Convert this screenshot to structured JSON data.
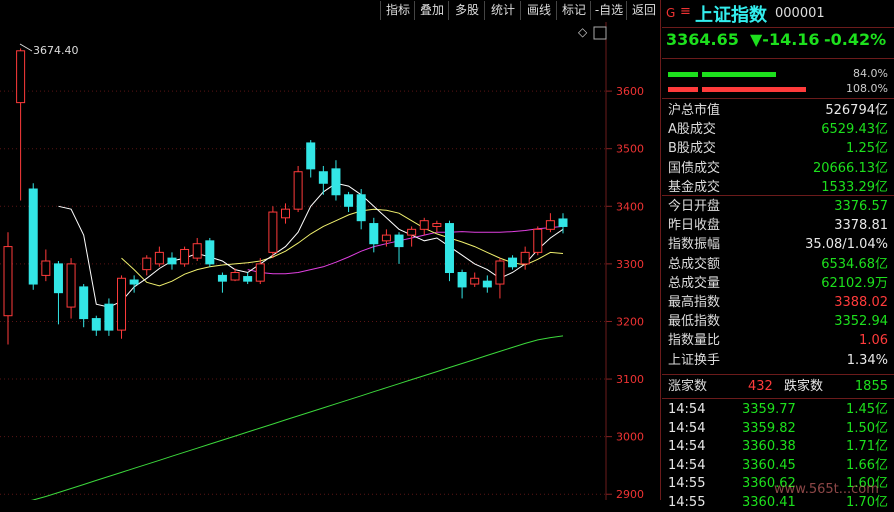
{
  "toolbar": {
    "items": [
      "指标",
      "叠加",
      "多股",
      "统计",
      "画线",
      "标记",
      "-自选",
      "返回"
    ]
  },
  "chart": {
    "y_axis_ticks": [
      "3600",
      "3500",
      "3400",
      "3300",
      "3200",
      "3100",
      "3000",
      "2900"
    ],
    "high_annotation": "3674.40",
    "diamond": "◇",
    "colors": {
      "up": "#ff3b3b",
      "down": "#33e6e6",
      "ma5": "#ffffff",
      "ma10": "#f0f06e",
      "ma20": "#e040e0",
      "ma60": "#3cd83c"
    }
  },
  "chart_data": {
    "type": "candlestick",
    "ylim": [
      2890,
      3720
    ],
    "candles": [
      {
        "o": 3210,
        "c": 3330,
        "h": 3355,
        "l": 3160
      },
      {
        "o": 3580,
        "c": 3670,
        "h": 3674,
        "l": 3410
      },
      {
        "o": 3430,
        "c": 3265,
        "h": 3440,
        "l": 3255
      },
      {
        "o": 3280,
        "c": 3305,
        "h": 3325,
        "l": 3270
      },
      {
        "o": 3300,
        "c": 3250,
        "h": 3305,
        "l": 3195
      },
      {
        "o": 3225,
        "c": 3300,
        "h": 3310,
        "l": 3205
      },
      {
        "o": 3260,
        "c": 3205,
        "h": 3265,
        "l": 3190
      },
      {
        "o": 3205,
        "c": 3185,
        "h": 3210,
        "l": 3175
      },
      {
        "o": 3230,
        "c": 3185,
        "h": 3240,
        "l": 3175
      },
      {
        "o": 3185,
        "c": 3275,
        "h": 3280,
        "l": 3170
      },
      {
        "o": 3272,
        "c": 3265,
        "h": 3280,
        "l": 3250
      },
      {
        "o": 3290,
        "c": 3310,
        "h": 3315,
        "l": 3280
      },
      {
        "o": 3300,
        "c": 3320,
        "h": 3330,
        "l": 3295
      },
      {
        "o": 3310,
        "c": 3300,
        "h": 3320,
        "l": 3290
      },
      {
        "o": 3300,
        "c": 3325,
        "h": 3330,
        "l": 3295
      },
      {
        "o": 3310,
        "c": 3335,
        "h": 3345,
        "l": 3305
      },
      {
        "o": 3340,
        "c": 3300,
        "h": 3345,
        "l": 3295
      },
      {
        "o": 3280,
        "c": 3270,
        "h": 3285,
        "l": 3250
      },
      {
        "o": 3272,
        "c": 3285,
        "h": 3292,
        "l": 3270
      },
      {
        "o": 3278,
        "c": 3270,
        "h": 3285,
        "l": 3265
      },
      {
        "o": 3270,
        "c": 3300,
        "h": 3310,
        "l": 3265
      },
      {
        "o": 3320,
        "c": 3390,
        "h": 3400,
        "l": 3310
      },
      {
        "o": 3380,
        "c": 3395,
        "h": 3405,
        "l": 3370
      },
      {
        "o": 3395,
        "c": 3460,
        "h": 3470,
        "l": 3390
      },
      {
        "o": 3510,
        "c": 3465,
        "h": 3515,
        "l": 3450
      },
      {
        "o": 3460,
        "c": 3440,
        "h": 3470,
        "l": 3420
      },
      {
        "o": 3465,
        "c": 3420,
        "h": 3480,
        "l": 3410
      },
      {
        "o": 3420,
        "c": 3400,
        "h": 3425,
        "l": 3390
      },
      {
        "o": 3420,
        "c": 3375,
        "h": 3430,
        "l": 3360
      },
      {
        "o": 3370,
        "c": 3335,
        "h": 3380,
        "l": 3320
      },
      {
        "o": 3340,
        "c": 3350,
        "h": 3360,
        "l": 3330
      },
      {
        "o": 3350,
        "c": 3330,
        "h": 3355,
        "l": 3300
      },
      {
        "o": 3350,
        "c": 3360,
        "h": 3365,
        "l": 3330
      },
      {
        "o": 3360,
        "c": 3375,
        "h": 3380,
        "l": 3350
      },
      {
        "o": 3365,
        "c": 3370,
        "h": 3375,
        "l": 3355
      },
      {
        "o": 3370,
        "c": 3285,
        "h": 3375,
        "l": 3270
      },
      {
        "o": 3285,
        "c": 3260,
        "h": 3290,
        "l": 3240
      },
      {
        "o": 3265,
        "c": 3275,
        "h": 3285,
        "l": 3260
      },
      {
        "o": 3270,
        "c": 3260,
        "h": 3280,
        "l": 3250
      },
      {
        "o": 3265,
        "c": 3305,
        "h": 3310,
        "l": 3240
      },
      {
        "o": 3310,
        "c": 3295,
        "h": 3315,
        "l": 3290
      },
      {
        "o": 3300,
        "c": 3320,
        "h": 3330,
        "l": 3290
      },
      {
        "o": 3320,
        "c": 3360,
        "h": 3365,
        "l": 3315
      },
      {
        "o": 3360,
        "c": 3375,
        "h": 3388,
        "l": 3355
      },
      {
        "o": 3378,
        "c": 3365,
        "h": 3388,
        "l": 3353
      }
    ],
    "ma5": [
      null,
      null,
      null,
      null,
      3400,
      3395,
      3350,
      3230,
      3225,
      3235,
      3260,
      3275,
      3292,
      3305,
      3310,
      3318,
      3312,
      3305,
      3290,
      3285,
      3300,
      3315,
      3330,
      3355,
      3400,
      3425,
      3440,
      3435,
      3420,
      3400,
      3380,
      3360,
      3350,
      3340,
      3345,
      3330,
      3315,
      3300,
      3290,
      3275,
      3285,
      3300,
      3325,
      3345,
      3360
    ],
    "ma10": [
      null,
      null,
      null,
      null,
      null,
      null,
      null,
      null,
      null,
      3310,
      3290,
      3268,
      3262,
      3270,
      3282,
      3290,
      3295,
      3298,
      3300,
      3302,
      3305,
      3312,
      3322,
      3336,
      3352,
      3365,
      3375,
      3385,
      3392,
      3395,
      3393,
      3388,
      3375,
      3362,
      3352,
      3345,
      3338,
      3330,
      3320,
      3310,
      3302,
      3298,
      3308,
      3320,
      3318
    ],
    "ma20": [
      null,
      null,
      null,
      null,
      null,
      null,
      null,
      null,
      null,
      null,
      null,
      null,
      null,
      null,
      null,
      null,
      null,
      null,
      null,
      3290,
      3285,
      3283,
      3283,
      3285,
      3290,
      3295,
      3303,
      3312,
      3322,
      3330,
      3335,
      3340,
      3345,
      3350,
      3355,
      3355,
      3356,
      3355,
      3355,
      3355,
      3356,
      3358,
      3361,
      3363,
      3365
    ],
    "ma60": [
      2880,
      2885,
      2890,
      2896,
      2903,
      2910,
      2917,
      2924,
      2931,
      2938,
      2945,
      2952,
      2959,
      2966,
      2973,
      2980,
      2987,
      2994,
      3001,
      3008,
      3015,
      3022,
      3029,
      3036,
      3043,
      3050,
      3057,
      3064,
      3071,
      3078,
      3085,
      3092,
      3099,
      3106,
      3113,
      3120,
      3127,
      3134,
      3141,
      3148,
      3155,
      3162,
      3168,
      3172,
      3175
    ]
  },
  "panel": {
    "g": "G",
    "menu_icon": "≡",
    "name": "上证指数",
    "code": "000001",
    "price": "3364.65",
    "change": "▼-14.16",
    "change_pct": "-0.42%",
    "bar1_pct": "84.0%",
    "bar2_pct": "108.0%",
    "stats": [
      {
        "label": "沪总市值",
        "value": "526794亿",
        "color": "white"
      },
      {
        "label": "A股成交",
        "value": "6529.43亿",
        "color": "green"
      },
      {
        "label": "B股成交",
        "value": "1.25亿",
        "color": "green"
      },
      {
        "label": "国债成交",
        "value": "20666.13亿",
        "color": "green"
      },
      {
        "label": "基金成交",
        "value": "1533.29亿",
        "color": "green"
      },
      {
        "label": "今日开盘",
        "value": "3376.57",
        "color": "green"
      },
      {
        "label": "昨日收盘",
        "value": "3378.81",
        "color": "white"
      },
      {
        "label": "指数振幅",
        "value": "35.08/1.04%",
        "color": "white"
      },
      {
        "label": "总成交额",
        "value": "6534.68亿",
        "color": "green"
      },
      {
        "label": "总成交量",
        "value": "62102.9万",
        "color": "green"
      },
      {
        "label": "最高指数",
        "value": "3388.02",
        "color": "red"
      },
      {
        "label": "最低指数",
        "value": "3352.94",
        "color": "green"
      },
      {
        "label": "指数量比",
        "value": "1.06",
        "color": "red"
      },
      {
        "label": "上证换手",
        "value": "1.34%",
        "color": "white"
      }
    ],
    "rise_label": "涨家数",
    "rise_value": "432",
    "fall_label": "跌家数",
    "fall_value": "1855",
    "ticks": [
      {
        "time": "14:54",
        "price": "3359.77",
        "vol": "1.45亿"
      },
      {
        "time": "14:54",
        "price": "3359.82",
        "vol": "1.50亿"
      },
      {
        "time": "14:54",
        "price": "3360.38",
        "vol": "1.71亿"
      },
      {
        "time": "14:54",
        "price": "3360.45",
        "vol": "1.66亿"
      },
      {
        "time": "14:55",
        "price": "3360.62",
        "vol": "1.60亿"
      },
      {
        "time": "14:55",
        "price": "3360.41",
        "vol": "1.70亿"
      }
    ],
    "watermark": "www.565t...com"
  }
}
